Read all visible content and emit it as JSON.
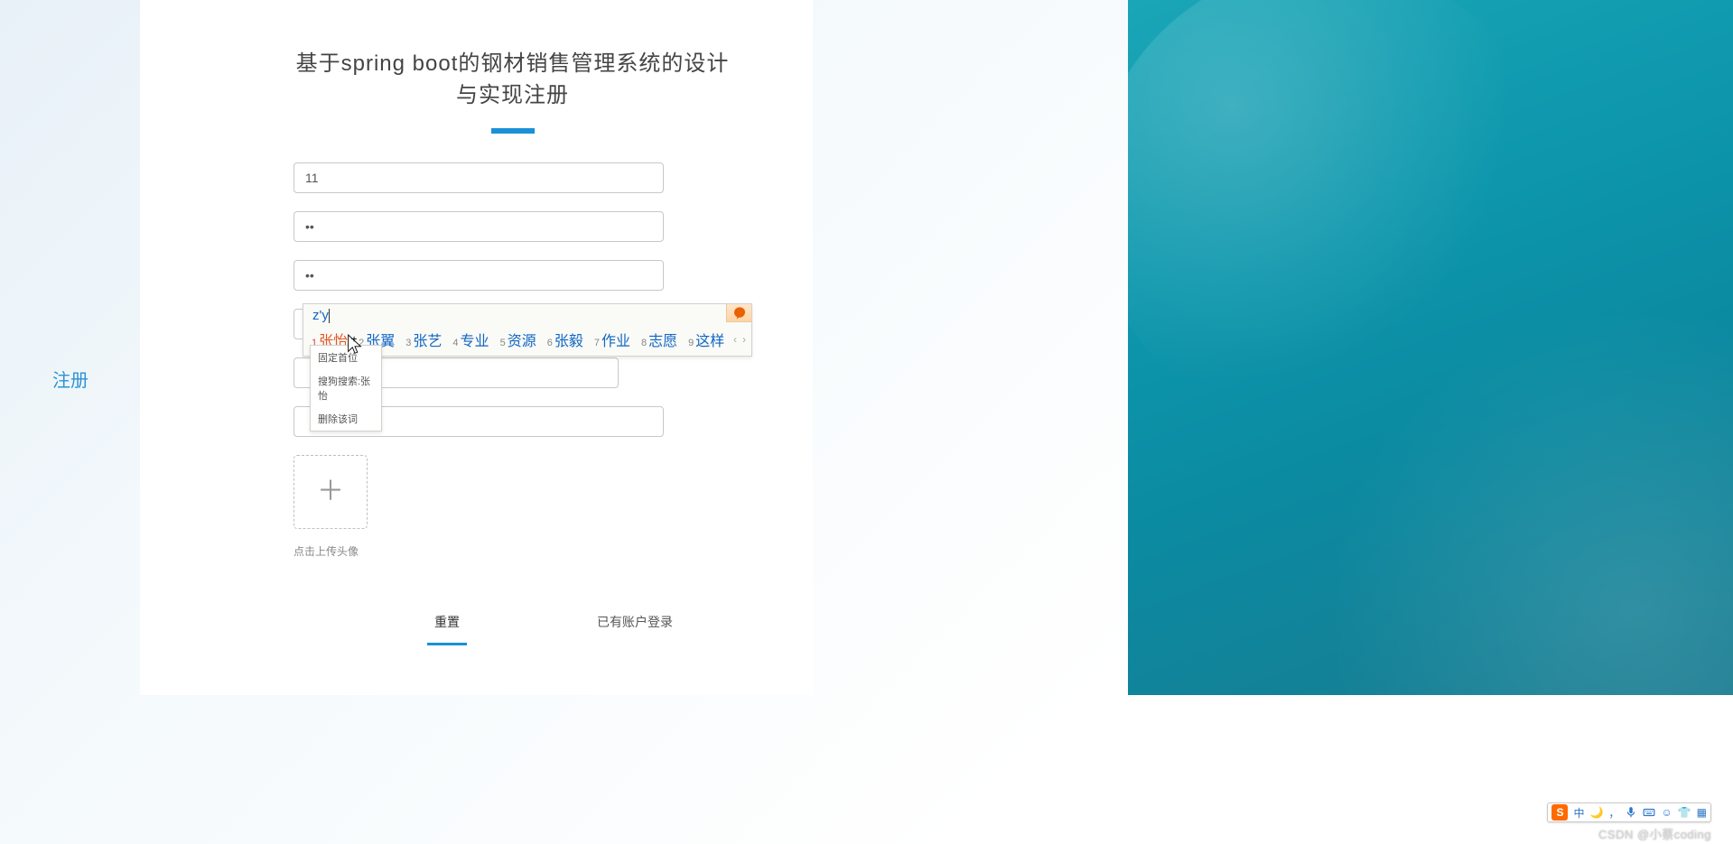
{
  "side_label": "注册",
  "page_title": "基于spring boot的钢材销售管理系统的设计与实现注册",
  "fields": {
    "username": {
      "value": "11",
      "placeholder": ""
    },
    "password": {
      "value": "••",
      "placeholder": ""
    },
    "password_confirm": {
      "value": "••",
      "placeholder": ""
    },
    "name": {
      "value": "zy",
      "placeholder": ""
    },
    "select_placeholder": "",
    "extra": {
      "value": "",
      "placeholder": ""
    }
  },
  "upload_hint": "点击上传头像",
  "actions": {
    "reset": "重置",
    "login_link": "已有账户登录"
  },
  "ime": {
    "composition": "z'y",
    "candidates": [
      {
        "n": "1",
        "w": "张怡"
      },
      {
        "n": "2",
        "w": "张翼"
      },
      {
        "n": "3",
        "w": "张艺"
      },
      {
        "n": "4",
        "w": "专业"
      },
      {
        "n": "5",
        "w": "资源"
      },
      {
        "n": "6",
        "w": "张毅"
      },
      {
        "n": "7",
        "w": "作业"
      },
      {
        "n": "8",
        "w": "志愿"
      },
      {
        "n": "9",
        "w": "这样"
      }
    ],
    "menu": {
      "pin": "固定首位",
      "search": "搜狗搜索:张怡",
      "delete": "删除该词"
    },
    "statusbar": {
      "brand_glyph": "S",
      "lang": "中",
      "moon": "🌙",
      "punct": "，",
      "mic": "mic",
      "kb": "⌨",
      "smile": "☺",
      "shirt": "👕",
      "grid": "▦"
    }
  },
  "watermark": "CSDN @小蔡coding"
}
